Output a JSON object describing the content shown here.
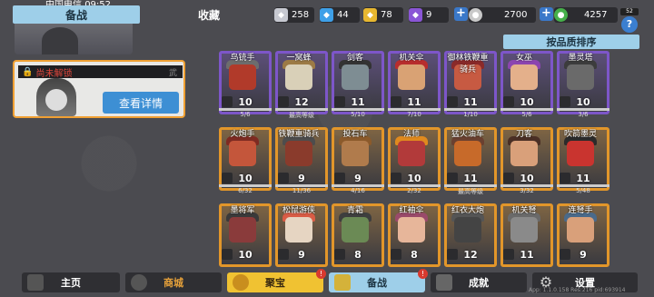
{
  "status_bar": {
    "carrier": "中国电信",
    "time": "09:52"
  },
  "tabs": [
    {
      "label": "备战",
      "active": true
    },
    {
      "label": "收藏",
      "active": false
    }
  ],
  "resources": [
    {
      "icon": "silver-shield-icon",
      "value": "258",
      "color": "#c7c9d1"
    },
    {
      "icon": "blue-shield-icon",
      "value": "44",
      "color": "#3ea0e8"
    },
    {
      "icon": "gold-shield-icon",
      "value": "78",
      "color": "#e7b730"
    },
    {
      "icon": "purple-shield-icon",
      "value": "9",
      "color": "#8a55d6"
    },
    {
      "icon": "coin-icon",
      "value": "2700",
      "color": "#c8c8c8"
    },
    {
      "icon": "jade-icon",
      "value": "4257",
      "color": "#46b04a"
    }
  ],
  "top_right_badge": "52",
  "locked_card": {
    "status": "尚未解锁",
    "glyph": "武",
    "detail_button": "查看详情"
  },
  "sort_button": "按品质排序",
  "heroes": [
    {
      "name": "鸟铳手",
      "level": "10",
      "progress": "5/6",
      "frame": "#7d56c9",
      "hat": "#6d6d6d",
      "face": "#b13a2a"
    },
    {
      "name": "一窝蜂",
      "level": "12",
      "progress": "最高等级",
      "frame": "#7d56c9",
      "hat": "#9c7a45",
      "face": "#d9d0b8"
    },
    {
      "name": "剑客",
      "level": "11",
      "progress": "5/10",
      "frame": "#7d56c9",
      "hat": "#333",
      "face": "#7e8d93"
    },
    {
      "name": "机关伞",
      "level": "11",
      "progress": "7/10",
      "frame": "#7d56c9",
      "hat": "#b82d2d",
      "face": "#d9a274"
    },
    {
      "name": "御林铁鞭重骑兵",
      "level": "11",
      "progress": "1/10",
      "frame": "#7d56c9",
      "hat": "#8a2a2a",
      "face": "#c75a42"
    },
    {
      "name": "女巫",
      "level": "10",
      "progress": "5/6",
      "frame": "#7d56c9",
      "hat": "#8c45b0",
      "face": "#e4b08b"
    },
    {
      "name": "墨灵塔",
      "level": "10",
      "progress": "3/6",
      "frame": "#7d56c9",
      "hat": "#3c3c3c",
      "face": "#6a6a6a"
    },
    {
      "name": "火炮手",
      "level": "10",
      "progress": "6/32",
      "frame": "#e2962a",
      "hat": "#7e2b22",
      "face": "#c4563b"
    },
    {
      "name": "铁鞭重骑兵",
      "level": "9",
      "progress": "11/36",
      "frame": "#e2962a",
      "hat": "#4d4d4d",
      "face": "#8a3b2c"
    },
    {
      "name": "投石车",
      "level": "9",
      "progress": "4/16",
      "frame": "#e2962a",
      "hat": "#8b5a2b",
      "face": "#b07b4c"
    },
    {
      "name": "法师",
      "level": "10",
      "progress": "2/32",
      "frame": "#e2962a",
      "hat": "#e08a1e",
      "face": "#b23a3a"
    },
    {
      "name": "猛火油车",
      "level": "11",
      "progress": "最高等级",
      "frame": "#e2962a",
      "hat": "#6a4030",
      "face": "#c76a2a"
    },
    {
      "name": "刀客",
      "level": "10",
      "progress": "3/32",
      "frame": "#e2962a",
      "hat": "#4a2f25",
      "face": "#d9a07a"
    },
    {
      "name": "吹箭墨灵",
      "level": "11",
      "progress": "5/48",
      "frame": "#e2962a",
      "hat": "#2b2b2b",
      "face": "#c9342f"
    },
    {
      "name": "墨将军",
      "level": "10",
      "progress": "",
      "frame": "#e2962a",
      "hat": "#3a3a3a",
      "face": "#8a3b3b"
    },
    {
      "name": "松鼠游侠",
      "level": "9",
      "progress": "",
      "frame": "#e2962a",
      "hat": "#d95c45",
      "face": "#e6d5c2"
    },
    {
      "name": "青霜",
      "level": "8",
      "progress": "",
      "frame": "#e2962a",
      "hat": "#3e3e3e",
      "face": "#6b8a55"
    },
    {
      "name": "红袖伞",
      "level": "8",
      "progress": "",
      "frame": "#e2962a",
      "hat": "#9a4a6a",
      "face": "#e7b69a"
    },
    {
      "name": "红衣大炮",
      "level": "12",
      "progress": "",
      "frame": "#e2962a",
      "hat": "#555",
      "face": "#444"
    },
    {
      "name": "机关弩",
      "level": "11",
      "progress": "",
      "frame": "#e2962a",
      "hat": "#6a6a6a",
      "face": "#8a8a8a"
    },
    {
      "name": "连弩手",
      "level": "9",
      "progress": "",
      "frame": "#e2962a",
      "hat": "#4a6a8a",
      "face": "#d9a07a"
    }
  ],
  "bottom_nav": [
    {
      "label": "主页",
      "icon": "home-icon",
      "active": false,
      "badge": ""
    },
    {
      "label": "商城",
      "icon": "shop-icon",
      "active": false,
      "badge": ""
    },
    {
      "label": "聚宝",
      "icon": "treasure-icon",
      "active": true,
      "badge": "!"
    },
    {
      "label": "备战",
      "icon": "prepare-icon",
      "active": false,
      "badge": "!"
    },
    {
      "label": "成就",
      "icon": "achievement-icon",
      "active": false,
      "badge": ""
    },
    {
      "label": "设置",
      "icon": "gear-icon",
      "active": false,
      "badge": ""
    }
  ],
  "version": "App: 1.1.0.158 Res:216 pid:693914"
}
